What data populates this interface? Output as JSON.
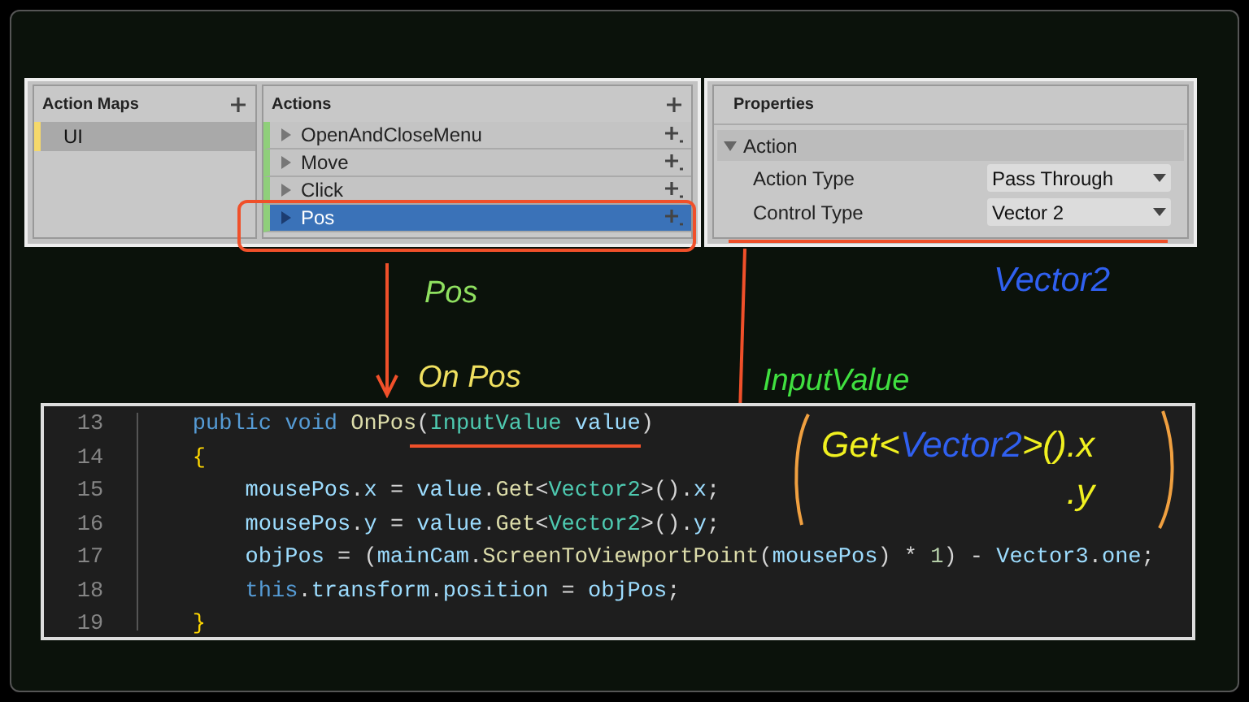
{
  "action_maps": {
    "title": "Action Maps",
    "items": [
      {
        "label": "UI",
        "selected": true
      }
    ]
  },
  "actions": {
    "title": "Actions",
    "items": [
      {
        "label": "OpenAndCloseMenu",
        "selected": false
      },
      {
        "label": "Move",
        "selected": false
      },
      {
        "label": "Click",
        "selected": false
      },
      {
        "label": "Pos",
        "selected": true
      }
    ]
  },
  "properties": {
    "title": "Properties",
    "section": {
      "label": "Action",
      "expanded": true
    },
    "fields": [
      {
        "label": "Action Type",
        "value": "Pass Through"
      },
      {
        "label": "Control Type",
        "value": "Vector 2"
      }
    ]
  },
  "notes": [
    {
      "text": "Pos",
      "color": "#8fe060"
    },
    {
      "text": "On Pos",
      "color": "#f0e060"
    },
    {
      "text": "InputValue",
      "color": "#40e040"
    },
    {
      "text": "Vector2",
      "color": "#3060f0"
    }
  ],
  "formula": {
    "parts": [
      {
        "text": "Get<",
        "color": "#f0f020"
      },
      {
        "text": "Vector2",
        "color": "#3060f0"
      },
      {
        "text": ">().x",
        "color": "#f0f020"
      }
    ],
    "second_line": ".y"
  },
  "code": [
    {
      "number": "13",
      "tokens": [
        {
          "kind": "keyword",
          "text": "    public void "
        },
        {
          "kind": "method",
          "text": "OnPos"
        },
        {
          "kind": "punct",
          "text": "("
        },
        {
          "kind": "type",
          "text": "InputValue"
        },
        {
          "kind": "variable",
          "text": " value"
        },
        {
          "kind": "punct",
          "text": ")"
        }
      ]
    },
    {
      "number": "14",
      "tokens": [
        {
          "kind": "brace",
          "text": "    {"
        }
      ]
    },
    {
      "number": "15",
      "tokens": [
        {
          "kind": "variable",
          "text": "        mousePos"
        },
        {
          "kind": "punct",
          "text": "."
        },
        {
          "kind": "variable",
          "text": "x"
        },
        {
          "kind": "punct",
          "text": " = "
        },
        {
          "kind": "variable",
          "text": "value"
        },
        {
          "kind": "punct",
          "text": "."
        },
        {
          "kind": "method",
          "text": "Get"
        },
        {
          "kind": "punct",
          "text": "<"
        },
        {
          "kind": "type",
          "text": "Vector2"
        },
        {
          "kind": "punct",
          "text": ">()."
        },
        {
          "kind": "variable",
          "text": "x"
        },
        {
          "kind": "punct",
          "text": ";"
        }
      ]
    },
    {
      "number": "16",
      "tokens": [
        {
          "kind": "variable",
          "text": "        mousePos"
        },
        {
          "kind": "punct",
          "text": "."
        },
        {
          "kind": "variable",
          "text": "y"
        },
        {
          "kind": "punct",
          "text": " = "
        },
        {
          "kind": "variable",
          "text": "value"
        },
        {
          "kind": "punct",
          "text": "."
        },
        {
          "kind": "method",
          "text": "Get"
        },
        {
          "kind": "punct",
          "text": "<"
        },
        {
          "kind": "type",
          "text": "Vector2"
        },
        {
          "kind": "punct",
          "text": ">()."
        },
        {
          "kind": "variable",
          "text": "y"
        },
        {
          "kind": "punct",
          "text": ";"
        }
      ]
    },
    {
      "number": "17",
      "tokens": [
        {
          "kind": "variable",
          "text": "        objPos"
        },
        {
          "kind": "punct",
          "text": " = ("
        },
        {
          "kind": "variable",
          "text": "mainCam"
        },
        {
          "kind": "punct",
          "text": "."
        },
        {
          "kind": "method",
          "text": "ScreenToViewportPoint"
        },
        {
          "kind": "punct",
          "text": "("
        },
        {
          "kind": "variable",
          "text": "mousePos"
        },
        {
          "kind": "punct",
          "text": ") * "
        },
        {
          "kind": "number",
          "text": "1"
        },
        {
          "kind": "punct",
          "text": ") - "
        },
        {
          "kind": "variable",
          "text": "Vector3"
        },
        {
          "kind": "punct",
          "text": "."
        },
        {
          "kind": "variable",
          "text": "one"
        },
        {
          "kind": "punct",
          "text": ";"
        }
      ]
    },
    {
      "number": "18",
      "tokens": [
        {
          "kind": "keyword",
          "text": "        this"
        },
        {
          "kind": "punct",
          "text": "."
        },
        {
          "kind": "variable",
          "text": "transform"
        },
        {
          "kind": "punct",
          "text": "."
        },
        {
          "kind": "variable",
          "text": "position"
        },
        {
          "kind": "punct",
          "text": " = "
        },
        {
          "kind": "variable",
          "text": "objPos"
        },
        {
          "kind": "punct",
          "text": ";"
        }
      ]
    },
    {
      "number": "19",
      "tokens": [
        {
          "kind": "brace",
          "text": "    }"
        }
      ]
    }
  ]
}
